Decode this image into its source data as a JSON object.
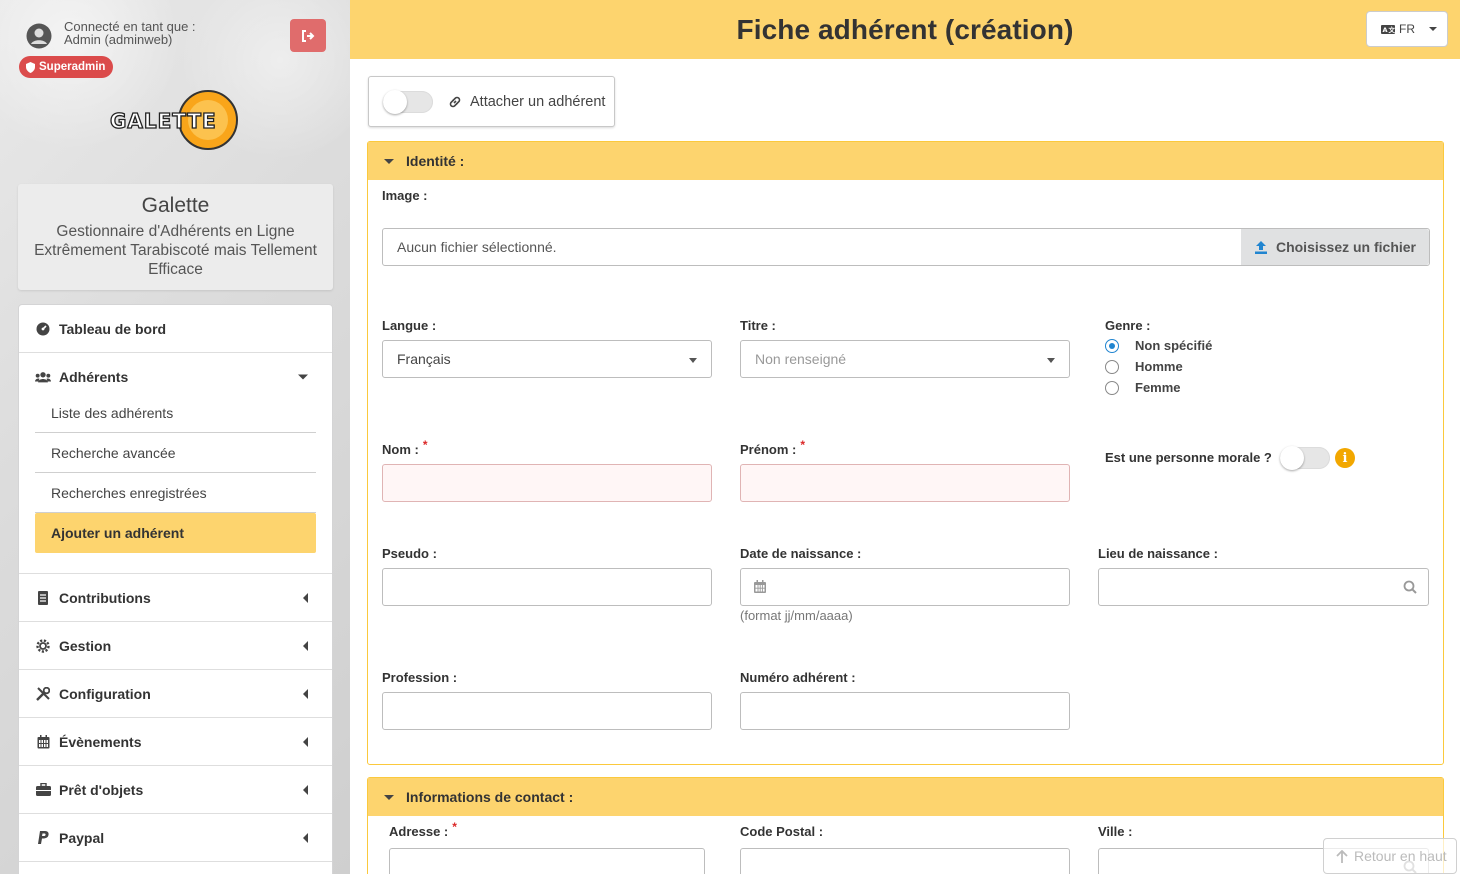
{
  "sidebar": {
    "connected_label": "Connecté en tant que :",
    "user": "Admin (adminweb)",
    "badge": "Superadmin",
    "logo_text": "GALETTE",
    "app_name": "Galette",
    "app_description": "Gestionnaire d'Adhérents en Ligne Extrêmement Tarabiscoté mais Tellement Efficace",
    "menu": {
      "dashboard": "Tableau de bord",
      "members": "Adhérents",
      "members_sub": {
        "list": "Liste des adhérents",
        "advanced_search": "Recherche avancée",
        "saved_searches": "Recherches enregistrées",
        "add_member": "Ajouter un adhérent"
      },
      "contributions": "Contributions",
      "management": "Gestion",
      "configuration": "Configuration",
      "events": "Évènements",
      "objects_lend": "Prêt d'objets",
      "paypal": "Paypal"
    }
  },
  "header": {
    "title": "Fiche adhérent (création)",
    "language": "FR"
  },
  "attach": {
    "label": "Attacher un adhérent",
    "enabled": false
  },
  "identity": {
    "heading": "Identité :",
    "image_label": "Image :",
    "file_placeholder": "Aucun fichier sélectionné.",
    "file_button": "Choisissez un fichier",
    "language_label": "Langue :",
    "language_value": "Français",
    "title_label": "Titre :",
    "title_value": "Non renseigné",
    "gender_label": "Genre :",
    "gender_options": [
      "Non spécifié",
      "Homme",
      "Femme"
    ],
    "gender_selected": "Non spécifié",
    "name_label": "Nom :",
    "firstname_label": "Prénom :",
    "required_mark": "*",
    "legal_person_label": "Est une personne morale ?",
    "legal_person": false,
    "nickname_label": "Pseudo :",
    "birthdate_label": "Date de naissance :",
    "birthdate_hint": "(format jj/mm/aaaa)",
    "birthplace_label": "Lieu de naissance :",
    "job_label": "Profession :",
    "member_number_label": "Numéro adhérent :"
  },
  "contact": {
    "heading": "Informations de contact :",
    "address_label": "Adresse :",
    "zip_label": "Code Postal :",
    "city_label": "Ville :"
  },
  "back_to_top": "Retour en haut",
  "colors": {
    "accent": "#fdd46e",
    "danger": "#db4b4b",
    "selected": "#2185d0",
    "info": "#f2a700"
  }
}
